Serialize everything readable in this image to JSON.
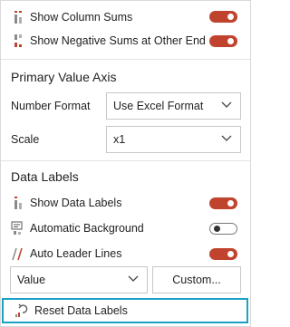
{
  "toggles_top": [
    {
      "label": "Show Column Sums",
      "on": true,
      "icon": "column-sums-icon"
    },
    {
      "label": "Show Negative Sums at Other End",
      "on": true,
      "icon": "negative-sums-icon"
    }
  ],
  "primary_axis": {
    "title": "Primary Value Axis",
    "number_format_label": "Number Format",
    "number_format_value": "Use Excel Format",
    "scale_label": "Scale",
    "scale_value": "x1"
  },
  "data_labels": {
    "title": "Data Labels",
    "show_data_labels": {
      "label": "Show Data Labels",
      "on": true
    },
    "automatic_background": {
      "label": "Automatic Background",
      "on": false
    },
    "auto_leader_lines": {
      "label": "Auto Leader Lines",
      "on": true
    },
    "value_select": "Value",
    "custom_button": "Custom..."
  },
  "reset": {
    "label": "Reset Data Labels"
  },
  "colors": {
    "toggle_on": "#c0432e",
    "focus_border": "#1ba1c4",
    "icon_red": "#c0432e"
  }
}
